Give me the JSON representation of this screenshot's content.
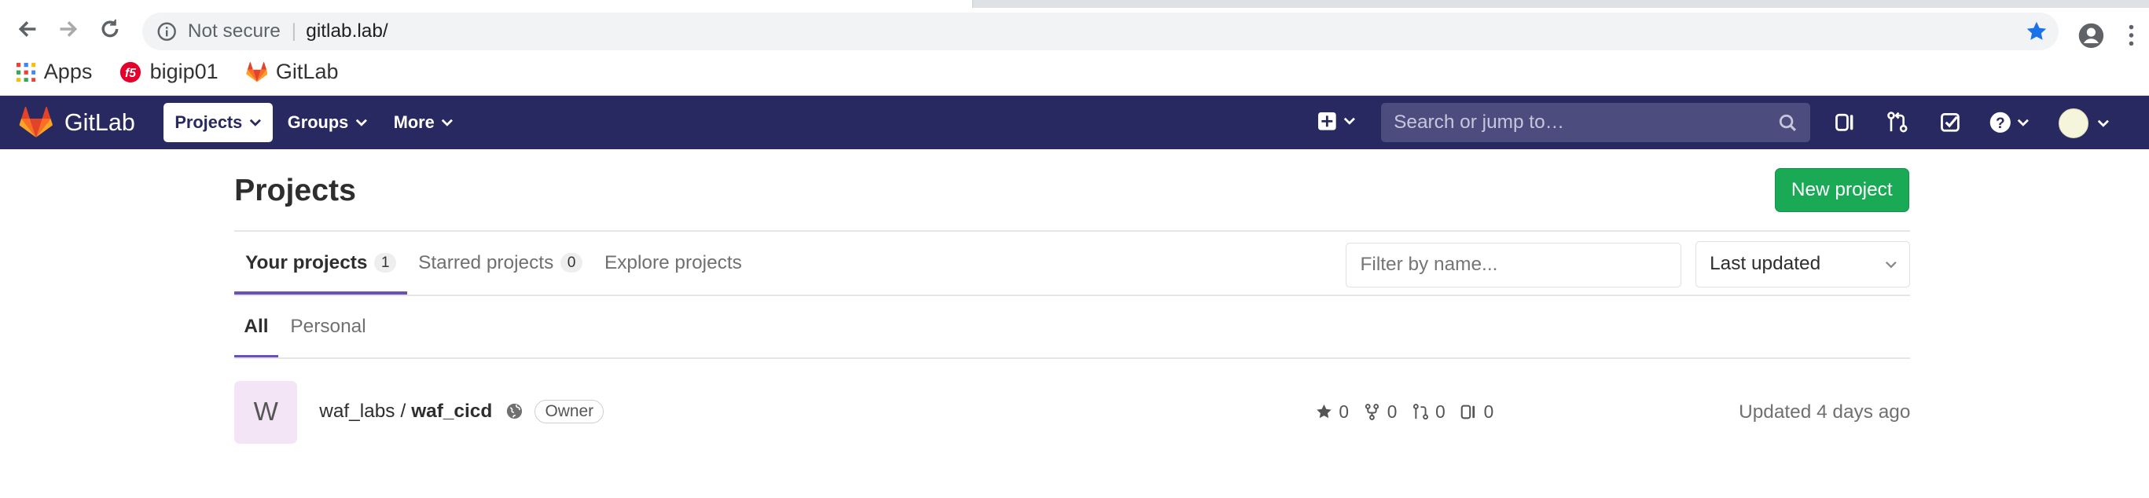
{
  "browser": {
    "not_secure": "Not secure",
    "url": "gitlab.lab/",
    "bookmarks": [
      {
        "label": "Apps",
        "icon": "apps-grid-icon"
      },
      {
        "label": "bigip01",
        "icon": "f5-icon"
      },
      {
        "label": "GitLab",
        "icon": "gitlab-icon"
      }
    ]
  },
  "navbar": {
    "logo_text": "GitLab",
    "menu": [
      {
        "label": "Projects",
        "active": true
      },
      {
        "label": "Groups",
        "active": false
      },
      {
        "label": "More",
        "active": false
      }
    ],
    "search_placeholder": "Search or jump to…",
    "brand_color": "#292961"
  },
  "page": {
    "title": "Projects",
    "new_project": "New project",
    "tabs": [
      {
        "label": "Your projects",
        "count": "1",
        "active": true
      },
      {
        "label": "Starred projects",
        "count": "0",
        "active": false
      },
      {
        "label": "Explore projects",
        "count": null,
        "active": false
      }
    ],
    "filter_placeholder": "Filter by name...",
    "sort_value": "Last updated",
    "subtabs": [
      {
        "label": "All",
        "active": true
      },
      {
        "label": "Personal",
        "active": false
      }
    ]
  },
  "projects": [
    {
      "avatar_letter": "W",
      "namespace": "waf_labs",
      "name": "waf_cicd",
      "visibility": "public",
      "role": "Owner",
      "stars": "0",
      "forks": "0",
      "merge_requests": "0",
      "issues": "0",
      "updated": "Updated 4 days ago"
    }
  ]
}
